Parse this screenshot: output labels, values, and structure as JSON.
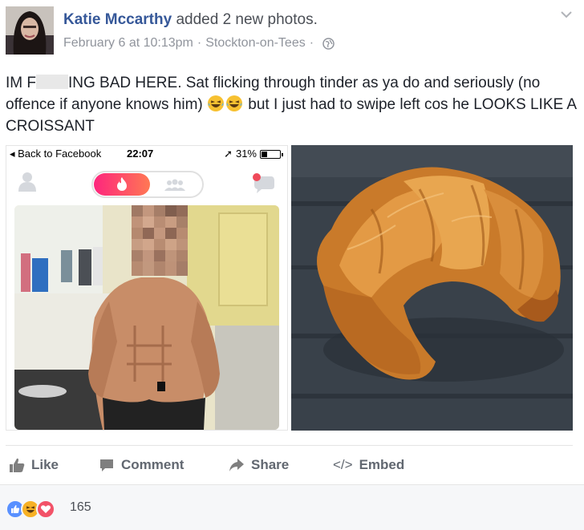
{
  "post": {
    "author_name": "Katie Mccarthy",
    "action_text": "added 2 new photos.",
    "date": "February 6 at 10:13pm",
    "location": "Stockton-on-Tees",
    "separator": "·",
    "text_part1": "IM F",
    "text_censored": "***",
    "text_part2": "ING BAD HERE. Sat flicking through tinder as ya do and seriously (no offence if anyone knows him)",
    "text_part3": "but I just had to swipe left cos he LOOKS LIKE A CROISSANT",
    "privacy_icon": "globe-icon"
  },
  "phone_ui": {
    "back_label": "Back to Facebook",
    "time": "22:07",
    "battery": "31%",
    "battery_level": 0.31
  },
  "actions": {
    "like": "Like",
    "comment": "Comment",
    "share": "Share",
    "embed_prefix": "</>",
    "embed": "Embed"
  },
  "reactions": {
    "count": "165",
    "types": [
      "like",
      "haha",
      "love"
    ]
  },
  "colors": {
    "link_blue": "#365899",
    "meta_gray": "#90949c",
    "action_gray": "#616770",
    "tinder_gradient_start": "#fd267d",
    "tinder_gradient_end": "#ff7854",
    "like_blue": "#5890ff",
    "love_red": "#f25268",
    "haha_yellow": "#f7b125"
  }
}
